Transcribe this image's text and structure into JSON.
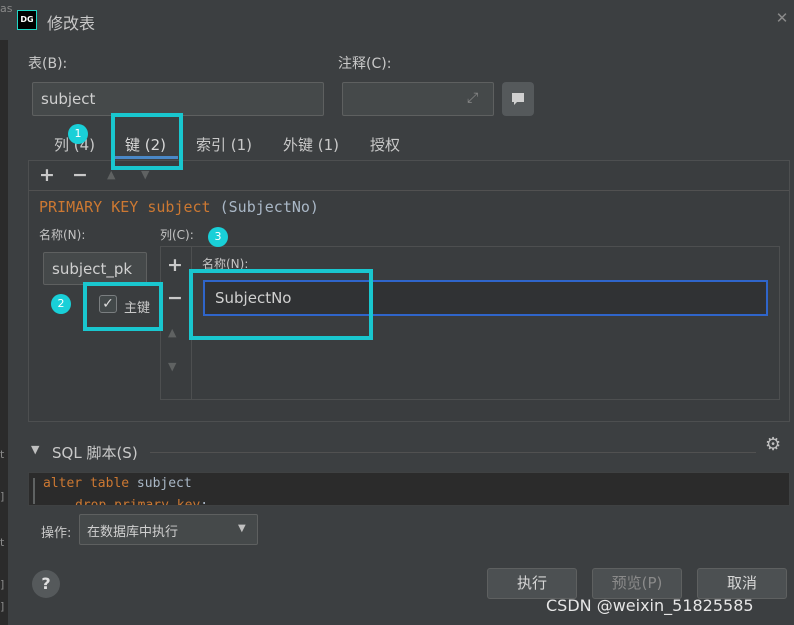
{
  "window": {
    "title": "修改表",
    "logo_text": "DG"
  },
  "left_strip": [
    "as",
    "t",
    "]",
    "t",
    "]",
    "]"
  ],
  "table_field": {
    "label": "表(B):",
    "value": "subject"
  },
  "comment_field": {
    "label": "注释(C):",
    "value": ""
  },
  "tabs": [
    {
      "label": "列 (4)"
    },
    {
      "label": "键 (2)",
      "selected": true
    },
    {
      "label": "索引 (1)"
    },
    {
      "label": "外键 (1)"
    },
    {
      "label": "授权"
    }
  ],
  "key_toolbar": {
    "add": "+",
    "remove": "−"
  },
  "key_definition": {
    "keyword": "PRIMARY KEY",
    "table": "subject",
    "columns": "(SubjectNo)"
  },
  "key_name": {
    "label": "名称(N):",
    "value": "subject_pk"
  },
  "primary_checkbox": {
    "label": "主键",
    "checked": true
  },
  "columns_section": {
    "label": "列(C):",
    "add": "+",
    "remove": "−",
    "header": "名称(N):",
    "rows": [
      "SubjectNo"
    ]
  },
  "sql_section": {
    "title": "SQL 脚本(S)",
    "lines": [
      {
        "kw": "alter table",
        "rest": " subject"
      },
      {
        "kw": "drop primary key",
        "rest": ";"
      }
    ]
  },
  "operation": {
    "label": "操作:",
    "value": "在数据库中执行"
  },
  "buttons": {
    "execute": "执行",
    "preview": "预览(P)",
    "cancel": "取消"
  },
  "help": "?",
  "watermark": "CSDN @weixin_51825585",
  "annotations": [
    "1",
    "2",
    "3"
  ],
  "colors": {
    "accent": "#19c7cf",
    "keyword": "#cc7832",
    "selection": "#2f65ca"
  }
}
